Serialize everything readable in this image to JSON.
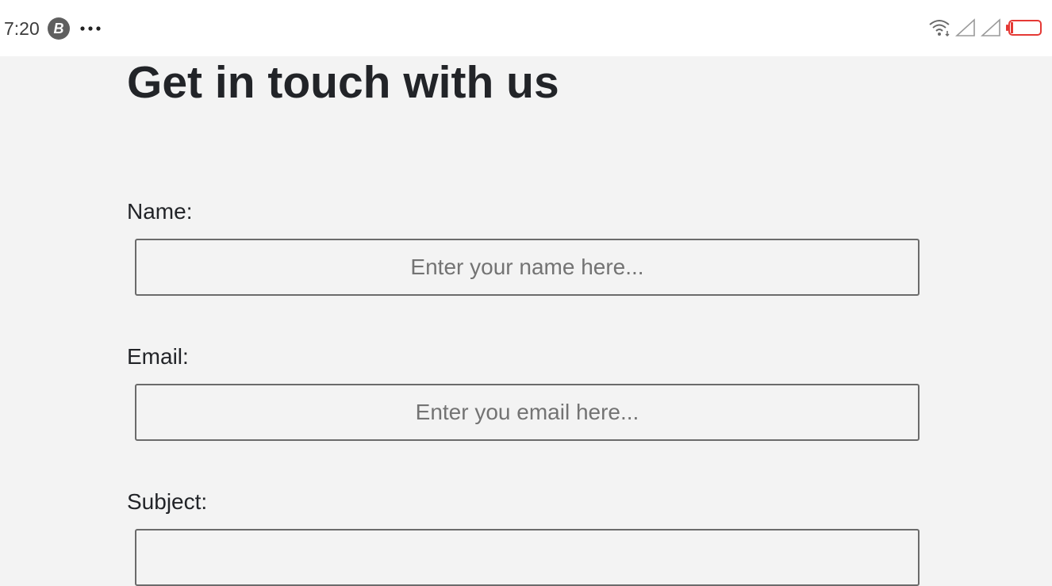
{
  "status_bar": {
    "time": "7:20",
    "app_icon_letter": "B",
    "icons": [
      "more-dots-icon",
      "wifi-icon",
      "signal-icon",
      "signal-icon",
      "battery-low-icon"
    ],
    "battery_color": "#e53935"
  },
  "page": {
    "title": "Get in touch with us",
    "background": "#f3f3f3"
  },
  "form": {
    "name": {
      "label": "Name:",
      "value": "",
      "placeholder": "Enter your name here..."
    },
    "email": {
      "label": "Email:",
      "value": "",
      "placeholder": "Enter you email here..."
    },
    "subject": {
      "label": "Subject:",
      "value": "",
      "placeholder": ""
    }
  }
}
